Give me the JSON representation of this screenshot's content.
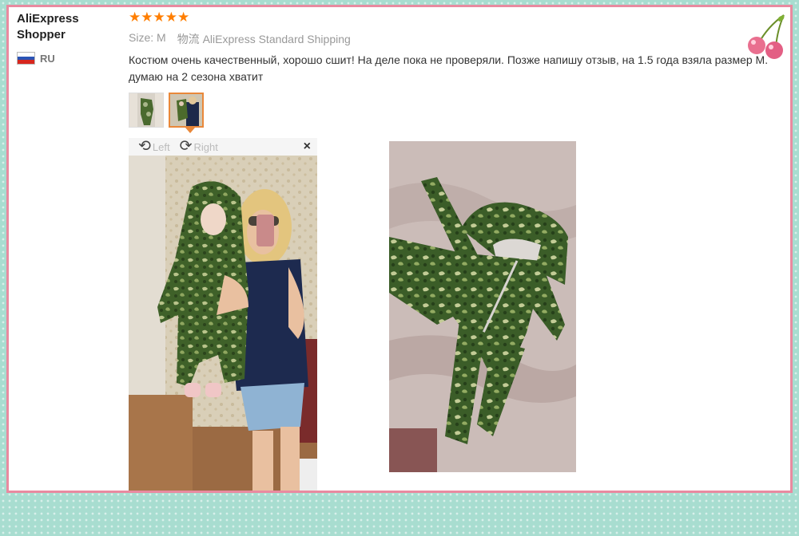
{
  "reviewer": {
    "name": "AliExpress Shopper",
    "country": "RU"
  },
  "rating": {
    "stars": 5
  },
  "meta": {
    "size_label": "Size:",
    "size_value": "M",
    "shipping_label": "物流",
    "shipping_value": "AliExpress Standard Shipping"
  },
  "review": {
    "text": "Костюм очень качественный, хорошо сшит! На деле пока не проверяли. Позже напишу отзыв, на 1.5 года взяла размер М. думаю на 2 сезона хватит"
  },
  "viewer": {
    "rotate_left": "Left",
    "rotate_right": "Right",
    "close": "×",
    "active_thumb": 2
  },
  "colors": {
    "accent": "#ff7e00",
    "frame_border": "#e98aa0",
    "background": "#a8ddd0",
    "active_thumb_border": "#e9883a"
  },
  "icons": {
    "star": "star-icon",
    "flag": "russia-flag-icon",
    "rotate_left": "rotate-left-icon",
    "rotate_right": "rotate-right-icon",
    "close": "close-icon",
    "decoration": "cherry-icon"
  }
}
